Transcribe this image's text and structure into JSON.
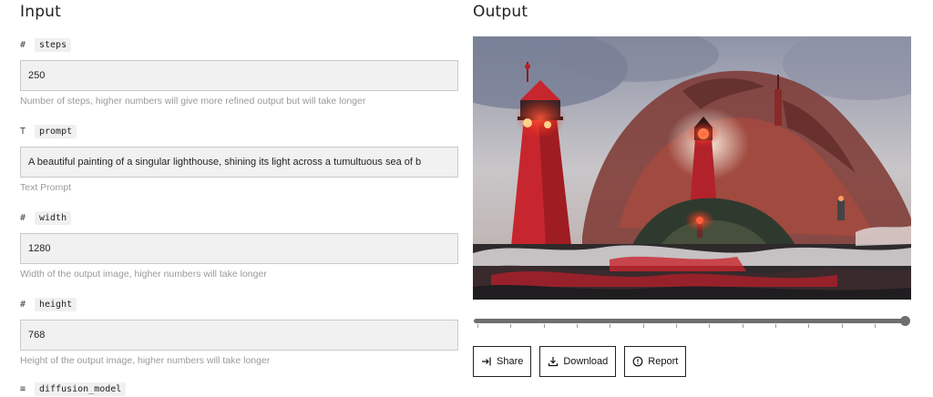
{
  "input": {
    "title": "Input",
    "fields": [
      {
        "type_glyph": "#",
        "name": "steps",
        "value": "250",
        "help": "Number of steps, higher numbers will give more refined output but will take longer"
      },
      {
        "type_glyph": "T",
        "name": "prompt",
        "value": "A beautiful painting of a singular lighthouse, shining its light across a tumultuous sea of b",
        "help": "Text Prompt"
      },
      {
        "type_glyph": "#",
        "name": "width",
        "value": "1280",
        "help": "Width of the output image, higher numbers will take longer"
      },
      {
        "type_glyph": "#",
        "name": "height",
        "value": "768",
        "help": "Height of the output image, higher numbers will take longer"
      },
      {
        "type_glyph": "≡",
        "name": "diffusion_model",
        "value": "",
        "help": ""
      }
    ]
  },
  "output": {
    "title": "Output",
    "image_icon": "lighthouse-painting",
    "slider_level": 1.0,
    "buttons": {
      "share": "Share",
      "download": "Download",
      "report": "Report"
    }
  }
}
